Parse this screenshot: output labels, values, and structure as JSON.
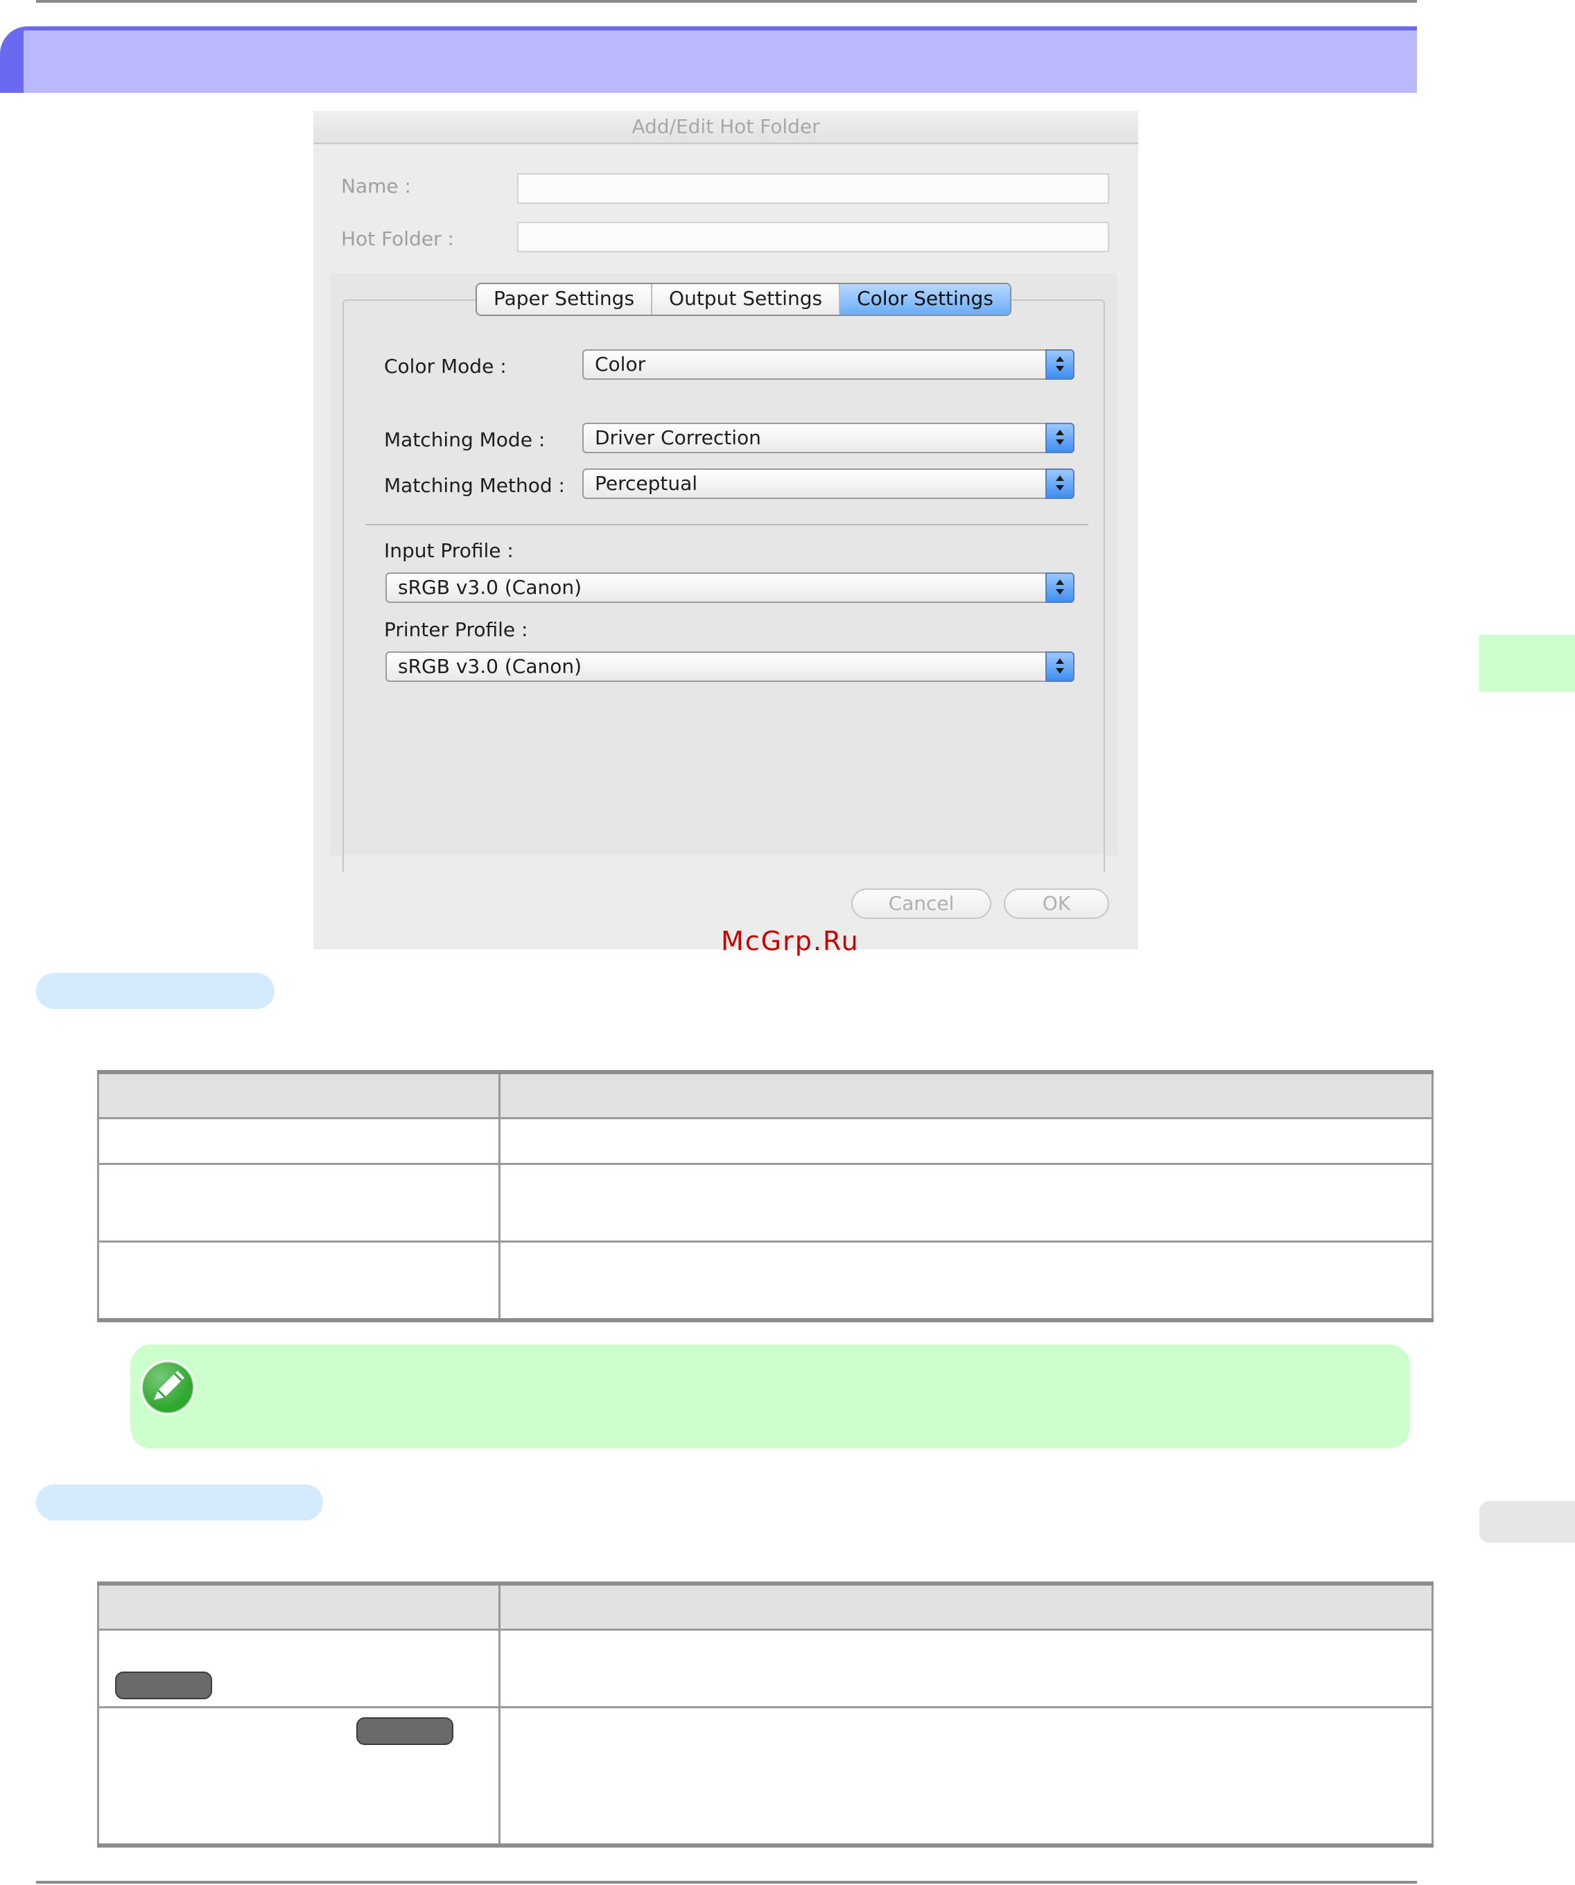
{
  "dialog": {
    "title": "Add/Edit Hot Folder",
    "name_label": "Name :",
    "name_value": "",
    "hot_folder_label": "Hot Folder :",
    "hot_folder_value": "",
    "tabs": [
      "Paper Settings",
      "Output Settings",
      "Color Settings"
    ],
    "active_tab": "Color Settings",
    "color_mode": {
      "label": "Color Mode :",
      "value": "Color"
    },
    "matching_mode": {
      "label": "Matching Mode :",
      "value": "Driver Correction"
    },
    "matching_method": {
      "label": "Matching Method :",
      "value": "Perceptual"
    },
    "input_profile": {
      "label": "Input Profile :",
      "value": "sRGB v3.0 (Canon)"
    },
    "printer_profile": {
      "label": "Printer Profile :",
      "value": "sRGB v3.0 (Canon)"
    },
    "cancel_label": "Cancel",
    "ok_label": "OK"
  },
  "watermark": "McGrp.Ru",
  "colors": {
    "title_bar": "#b9b9fb",
    "title_accent": "#6a6af0",
    "section_pill": "#d3ebfc",
    "note_bg": "#ccffcc",
    "active_tab": "#6aaef8",
    "watermark": "#c80000"
  },
  "icons": {
    "note": "pencil-note-icon",
    "stepper": "up-down-stepper-icon"
  }
}
